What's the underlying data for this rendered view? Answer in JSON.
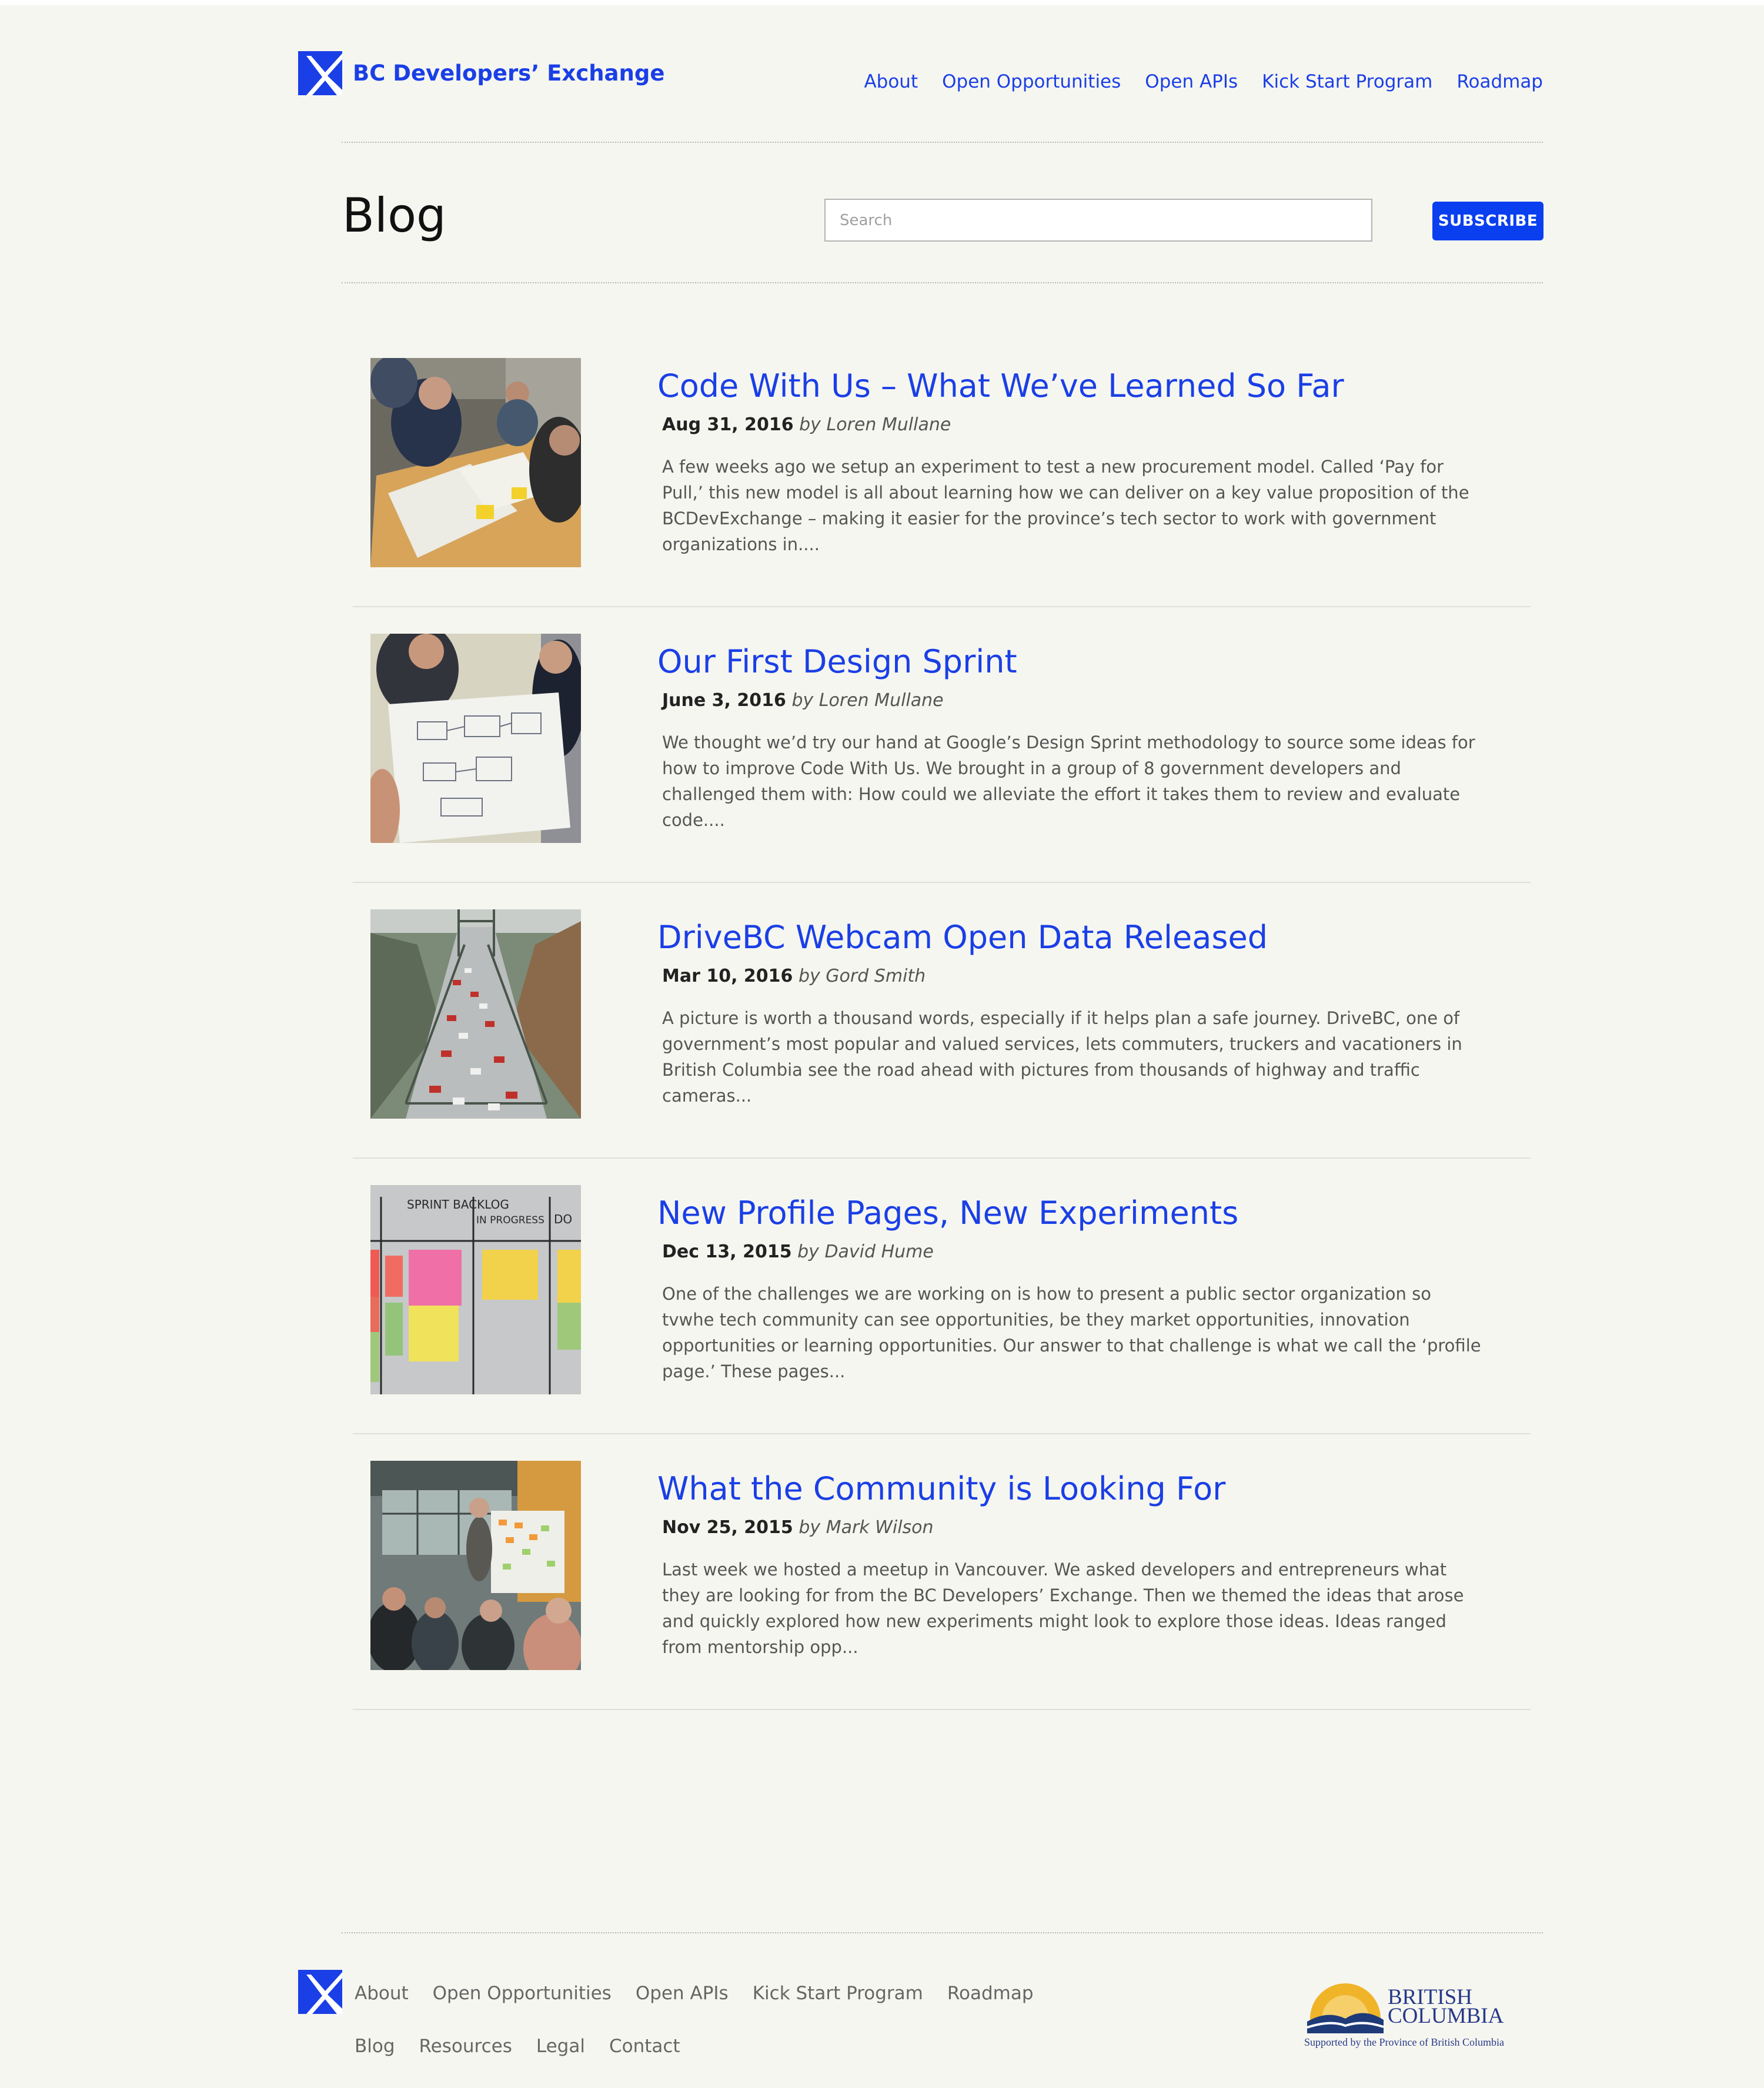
{
  "header": {
    "brand_name": "BC Developers’ Exchange",
    "nav": [
      "About",
      "Open Opportunities",
      "Open APIs",
      "Kick Start Program",
      "Roadmap"
    ]
  },
  "blog": {
    "title": "Blog",
    "search_placeholder": "Search",
    "subscribe_label": "SUBSCRIBE"
  },
  "posts": [
    {
      "title": "Code With Us – What We’ve Learned So Far",
      "date": "Aug 31, 2016",
      "author": "by Loren Mullane",
      "excerpt": "A few weeks ago we setup an experiment to test a new procurement model. Called ‘Pay for Pull,’ this new model is all about learning how we can deliver on a key value proposition of the BCDevExchange – making it easier for the province’s tech sector to work with government organizations in....",
      "image": "people-working-at-table-photo"
    },
    {
      "title": "Our First Design Sprint",
      "date": "June 3, 2016",
      "author": "by Loren Mullane",
      "excerpt": "We thought we’d try our hand at Google’s Design Sprint methodology to source some ideas for how to improve Code With Us. We brought in a group of 8 government developers and challenged them with: How could we alleviate the effort it takes them to review and evaluate code....",
      "image": "design-sprint-poster-photo"
    },
    {
      "title": "DriveBC Webcam Open Data Released",
      "date": "Mar 10, 2016",
      "author": "by Gord Smith",
      "excerpt": "A picture is worth a thousand words, especially if it helps plan a safe journey. DriveBC, one of government’s most popular and valued services, lets commuters, truckers and vacationers in British Columbia see the road ahead with pictures from thousands of highway and traffic cameras...",
      "image": "bridge-traffic-webcam-photo"
    },
    {
      "title": "New Profile Pages, New Experiments",
      "date": "Dec 13, 2015",
      "author": "by David Hume",
      "excerpt": "One of the challenges we are working on is how to present a public sector organization so tvwhe tech community can see opportunities, be they market opportunities, innovation opportunities or learning opportunities. Our answer to that challenge is what we call the ‘profile page.’ These pages...",
      "image": "sprint-backlog-sticky-notes-photo",
      "image_text": {
        "col1": "SPRINT BACKLOG",
        "col2": "IN PROGRESS",
        "col3": "DO"
      }
    },
    {
      "title": "What the Community is Looking For",
      "date": "Nov 25, 2015",
      "author": "by Mark Wilson",
      "excerpt": "Last week we hosted a meetup in Vancouver. We asked developers and entrepreneurs what they are looking for from the BC Developers’ Exchange. Then we themed the ideas that arose and quickly explored how new experiments might look to explore those ideas. Ideas ranged from mentorship opp...",
      "image": "community-meetup-presentation-photo"
    }
  ],
  "footer": {
    "nav_row1": [
      "About",
      "Open Opportunities",
      "Open APIs",
      "Kick Start Program",
      "Roadmap"
    ],
    "nav_row2": [
      "Blog",
      "Resources",
      "Legal",
      "Contact"
    ],
    "bc_logo": {
      "line1": "BRITISH",
      "line2": "COLUMBIA",
      "tagline": "Supported by the Province of British Columbia"
    }
  },
  "colors": {
    "brand_blue": "#1a3fe6",
    "button_blue": "#0a3ff0",
    "page_bg": "#f6f6f0"
  }
}
